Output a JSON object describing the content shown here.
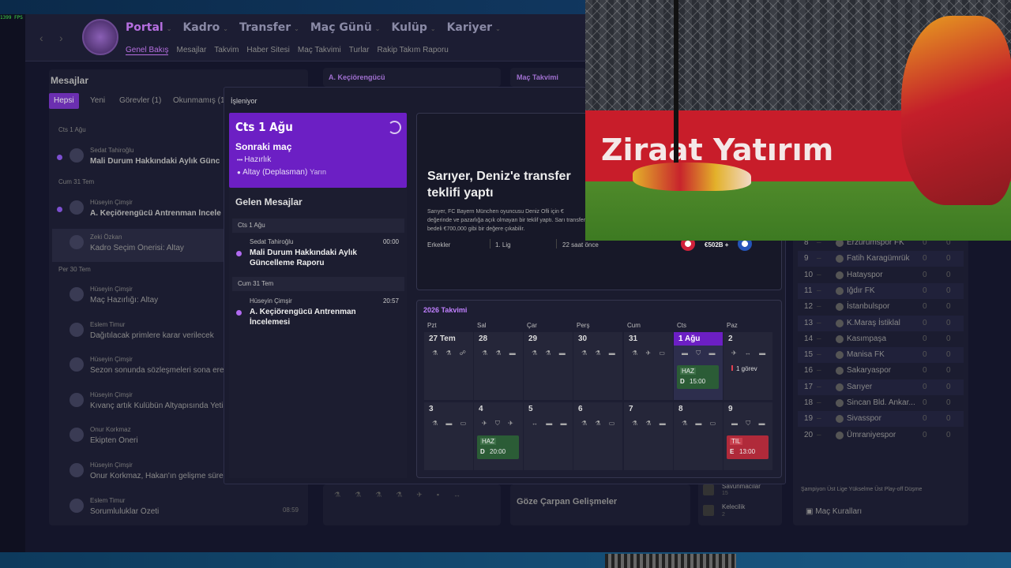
{
  "overlay": {
    "fps": "1399 FPS"
  },
  "nav": {
    "tabs": [
      "Portal",
      "Kadro",
      "Transfer",
      "Maç Günü",
      "Kulüp",
      "Kariyer"
    ],
    "subtabs": [
      "Genel Bakış",
      "Mesajlar",
      "Takvim",
      "Haber Sitesi",
      "Maç Takvimi",
      "Turlar",
      "Rakip Takım Raporu"
    ]
  },
  "messages_panel": {
    "title": "Mesajlar",
    "filters": [
      "Hepsi",
      "Yeni",
      "Görevler (1)",
      "Okunmamış (1"
    ],
    "groups": [
      {
        "date": "Cts 1 Ağu"
      },
      {
        "date": "Cum 31 Tem"
      },
      {
        "date": "Per 30 Tem"
      }
    ],
    "items": [
      {
        "sender": "Sedat Tahiroğlu",
        "subject": "Mali Durum Hakkındaki Aylık Günc",
        "bold": true,
        "dot": true
      },
      {
        "sender": "Hüseyin Çimşir",
        "subject": "A. Keçiörengücü Antrenman İncele",
        "bold": true,
        "dot": true
      },
      {
        "sender": "Zeki Özkan",
        "subject": "Kadro Seçim Önerisi: Altay",
        "bold": false,
        "dot": false
      },
      {
        "sender": "Hüseyin Çimşir",
        "subject": "Maç Hazırlığı: Altay",
        "bold": false
      },
      {
        "sender": "Eslem Timur",
        "subject": "Dağıtılacak primlere karar verilecek",
        "bold": false
      },
      {
        "sender": "Hüseyin Çimşir",
        "subject": "Sezon sonunda sözleşmeleri sona erec",
        "bold": false
      },
      {
        "sender": "Hüseyin Çimşir",
        "subject": "Kıvanç artık Kulübün Altyapısında Yetiş",
        "bold": false
      },
      {
        "sender": "Onur Korkmaz",
        "subject": "Ekipten Öneri",
        "bold": false
      },
      {
        "sender": "Hüseyin Çimşir",
        "subject": "Onur Korkmaz, Hakan'ın gelişme sürec",
        "bold": false
      },
      {
        "sender": "Eslem Timur",
        "subject": "Sorumluluklar Özeti",
        "bold": false,
        "time": "08:59"
      }
    ]
  },
  "bg_panels": {
    "club_title": "A. Keçiörengücü",
    "fixtures_title": "Maç Takvimi",
    "developments": "Göze Çarpan Gelişmeler",
    "stat1_label": "Savunmacılar",
    "stat1_value": "15",
    "stat2_label": "Kelecilik",
    "stat2_value": "2"
  },
  "league_table": [
    {
      "pos": "8",
      "team": "Erzurumspor FK",
      "a": "0",
      "b": "0"
    },
    {
      "pos": "9",
      "team": "Fatih Karagümrük",
      "a": "0",
      "b": "0"
    },
    {
      "pos": "10",
      "team": "Hatayspor",
      "a": "0",
      "b": "0"
    },
    {
      "pos": "11",
      "team": "Iğdır FK",
      "a": "0",
      "b": "0"
    },
    {
      "pos": "12",
      "team": "İstanbulspor",
      "a": "0",
      "b": "0"
    },
    {
      "pos": "13",
      "team": "K.Maraş İstiklal",
      "a": "0",
      "b": "0"
    },
    {
      "pos": "14",
      "team": "Kasımpaşa",
      "a": "0",
      "b": "0"
    },
    {
      "pos": "15",
      "team": "Manisa FK",
      "a": "0",
      "b": "0"
    },
    {
      "pos": "16",
      "team": "Sakaryaspor",
      "a": "0",
      "b": "0"
    },
    {
      "pos": "17",
      "team": "Sarıyer",
      "a": "0",
      "b": "0"
    },
    {
      "pos": "18",
      "team": "Sincan Bld. Ankar...",
      "a": "0",
      "b": "0"
    },
    {
      "pos": "19",
      "team": "Sivasspor",
      "a": "0",
      "b": "0"
    },
    {
      "pos": "20",
      "team": "Ümraniyespor",
      "a": "0",
      "b": "0"
    }
  ],
  "legend": {
    "text": "Şampiyon   Üst Lige Yükselme   Üst Play-off   Düşme",
    "rules": "Maç Kuralları"
  },
  "modal": {
    "title": "İşleniyor",
    "next_match": {
      "date": "Cts 1 Ağu",
      "label": "Sonraki maç",
      "type": "Hazırlık",
      "opponent": "Altay (Deplasman)",
      "when": "Yarın"
    },
    "inbox": {
      "title": "Gelen Mesajlar",
      "groups": [
        {
          "date": "Cts 1 Ağu",
          "sender": "Sedat Tahiroğlu",
          "time": "00:00",
          "subject": "Mali Durum Hakkındaki Aylık Güncelleme Raporu"
        },
        {
          "date": "Cum 31 Tem",
          "sender": "Hüseyin Çimşir",
          "time": "20:57",
          "subject": "A. Keçiörengücü Antrenman İncelemesi"
        }
      ]
    },
    "news": {
      "title": "Sarıyer, Deniz'e transfer teklifi yaptı",
      "body": "Sarıyer, FC Bayern München oyuncusu Deniz Ofli için € değerinde ve pazarlığa açık olmayan bir teklif yaptı. Sarı transfer bedeli €700,000 gibi bir değere çıkabilir.",
      "category": "Erkekler",
      "league": "1. Lig",
      "time": "22 saat önce",
      "value": "€502B +"
    },
    "calendar": {
      "title": "2026 Takvimi",
      "days": [
        "Pzt",
        "Sal",
        "Çar",
        "Perş",
        "Cum",
        "Cts",
        "Paz"
      ],
      "week1": [
        "27 Tem",
        "28",
        "29",
        "30",
        "31",
        "1 Ağu",
        "2"
      ],
      "week2": [
        "3",
        "4",
        "5",
        "6",
        "7",
        "8",
        "9"
      ],
      "week1_icons": [
        "⚗ ⚗ ☍",
        "⚗ ⚗ ▬",
        "⚗ ⚗ ▬",
        "⚗ ⚗ ▬",
        "⚗ ✈ ▭",
        "▬ ⛉ ▬",
        "✈ ↔ ▬"
      ],
      "week2_icons": [
        "⚗ ▬ ▭",
        "✈ ⛉ ✈",
        "↔ ▬ ▬",
        "⚗ ⚗ ▭",
        "⚗ ⚗ ▬",
        "⚗ ▬ ▭",
        "▬ ⛉ ▬"
      ],
      "match1": {
        "tag": "HAZ",
        "venue": "D",
        "time": "15:00"
      },
      "task": "1 görev",
      "match2": {
        "tag": "HAZ",
        "venue": "D",
        "time": "20:00"
      },
      "match3": {
        "tag": "TIL",
        "venue": "E",
        "time": "13:00"
      }
    }
  },
  "video": {
    "board_text": "Ziraat Yatırım",
    "board_text2": "Zi"
  }
}
